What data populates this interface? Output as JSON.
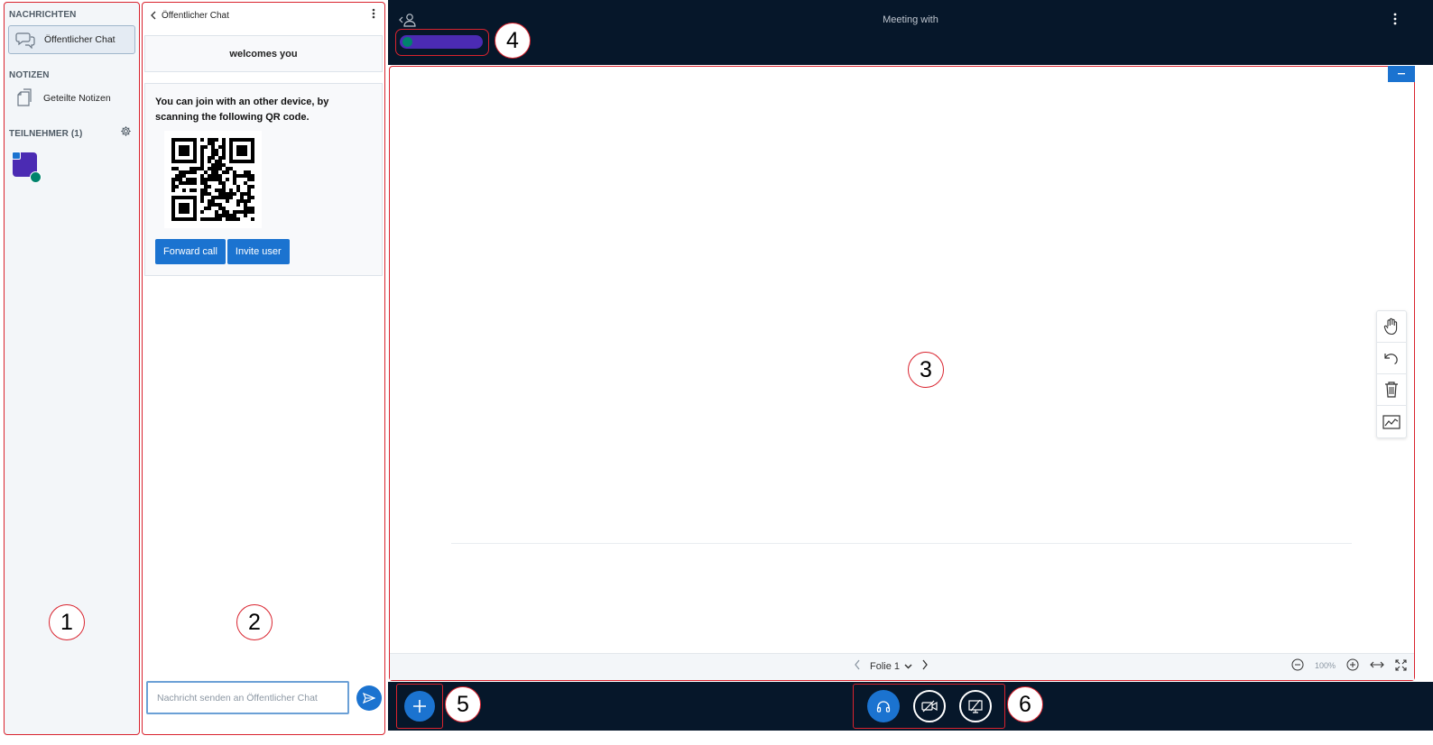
{
  "userlist": {
    "messages_title": "NACHRICHTEN",
    "public_chat_label": "Öffentlicher Chat",
    "notes_title": "NOTIZEN",
    "shared_notes_label": "Geteilte Notizen",
    "participants_title": "TEILNEHMER (1)"
  },
  "chat": {
    "header_title": "Öffentlicher Chat",
    "welcome": "welcomes you",
    "qr_text": "You can join with an other device, by scanning the following QR code.",
    "forward_call": "Forward call",
    "invite_user": "Invite user",
    "input_placeholder": "Nachricht senden an Öffentlicher Chat"
  },
  "navbar": {
    "title": "Meeting with"
  },
  "presentation": {
    "slide_label": "Folie 1",
    "zoom_level": "100%"
  },
  "callouts": [
    "1",
    "2",
    "3",
    "4",
    "5",
    "6"
  ],
  "colors": {
    "primary": "#1b73d0",
    "navbar_bg": "#06172a",
    "avatar": "#4b2bb3",
    "voice": "#00836c",
    "annotation": "#d9232e"
  },
  "icons": {
    "chat": "chat-bubbles-icon",
    "notes": "copy-notes-icon",
    "settings": "gear-icon",
    "user": "user-icon",
    "more": "vertical-dots-icon",
    "hand": "hand-icon",
    "undo": "undo-icon",
    "delete": "trash-icon",
    "multi": "line-chart-icon",
    "send": "send-icon",
    "plus": "plus-icon",
    "audio": "headphones-icon",
    "video": "video-off-icon",
    "screen": "screen-share-off-icon"
  }
}
